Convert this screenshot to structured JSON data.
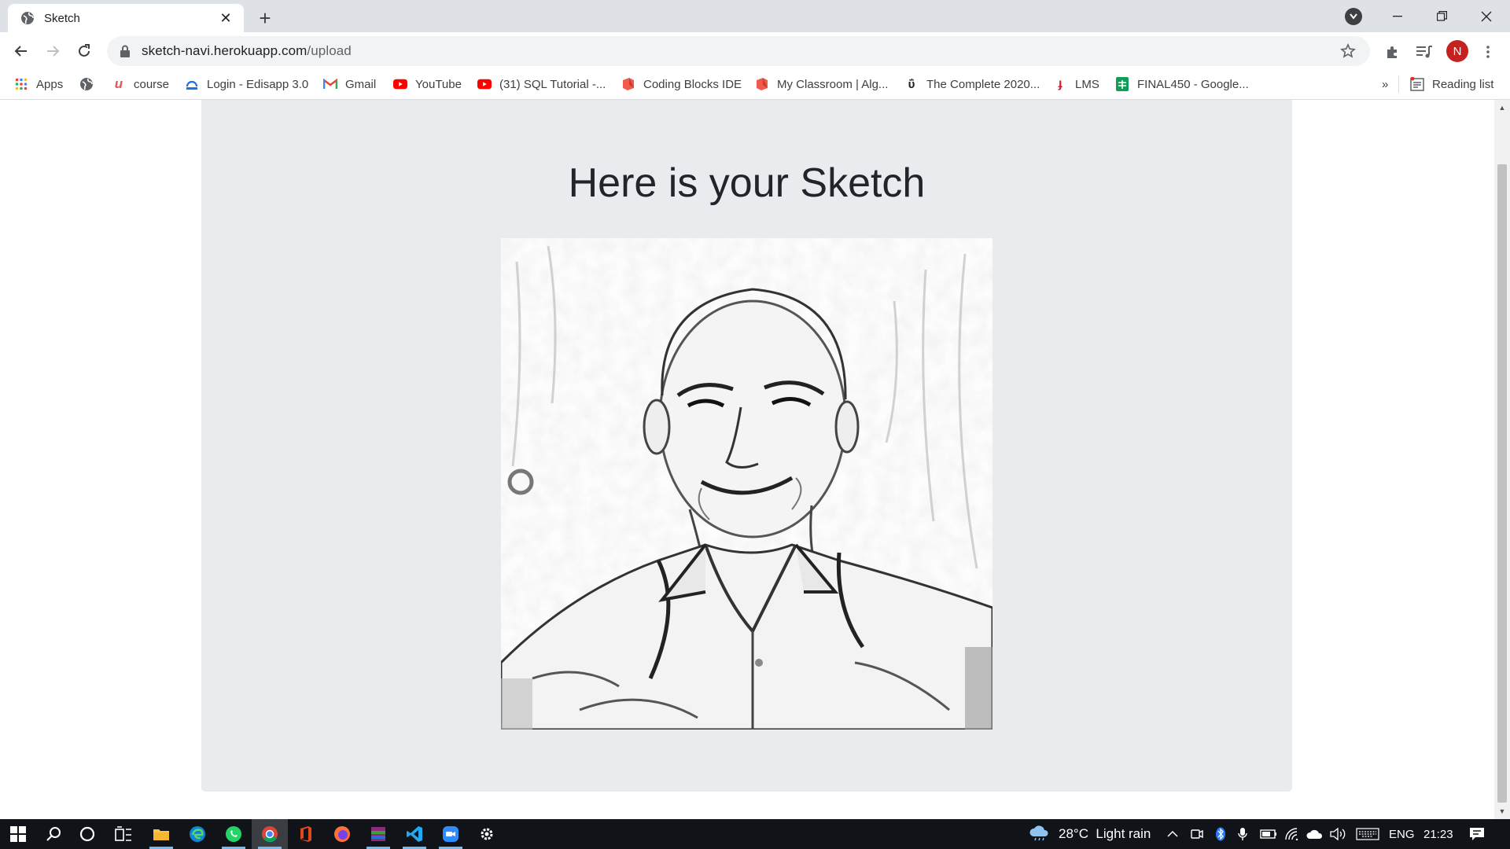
{
  "browser": {
    "tab": {
      "title": "Sketch"
    },
    "address": {
      "host": "sketch-navi.herokuapp.com",
      "path": "/upload"
    },
    "profile_initial": "N",
    "bookmarks": [
      {
        "label": "Apps",
        "icon": "apps-grid-icon"
      },
      {
        "label": "",
        "icon": "globe-icon"
      },
      {
        "label": "course",
        "icon": "udemy-icon"
      },
      {
        "label": "Login - Edisapp 3.0",
        "icon": "edisapp-icon"
      },
      {
        "label": "Gmail",
        "icon": "gmail-icon"
      },
      {
        "label": "YouTube",
        "icon": "youtube-icon"
      },
      {
        "label": "(31) SQL Tutorial -...",
        "icon": "youtube-icon"
      },
      {
        "label": "Coding Blocks IDE",
        "icon": "coding-blocks-icon"
      },
      {
        "label": "My Classroom | Alg...",
        "icon": "coding-blocks-icon"
      },
      {
        "label": "The Complete 2020...",
        "icon": "udemy-u-icon"
      },
      {
        "label": "LMS",
        "icon": "lms-icon"
      },
      {
        "label": "FINAL450 - Google...",
        "icon": "google-sheets-icon"
      }
    ],
    "more_bookmarks": "»",
    "reading_list": "Reading list"
  },
  "page": {
    "heading": "Here is your Sketch",
    "image_description_icon": "pencil-sketch-portrait"
  },
  "taskbar": {
    "weather": "28°C  Light rain",
    "language": "ENG",
    "time": "21:23"
  },
  "colors": {
    "card_bg": "#e9ecef",
    "heading": "#212529",
    "taskbar": "#101418"
  }
}
